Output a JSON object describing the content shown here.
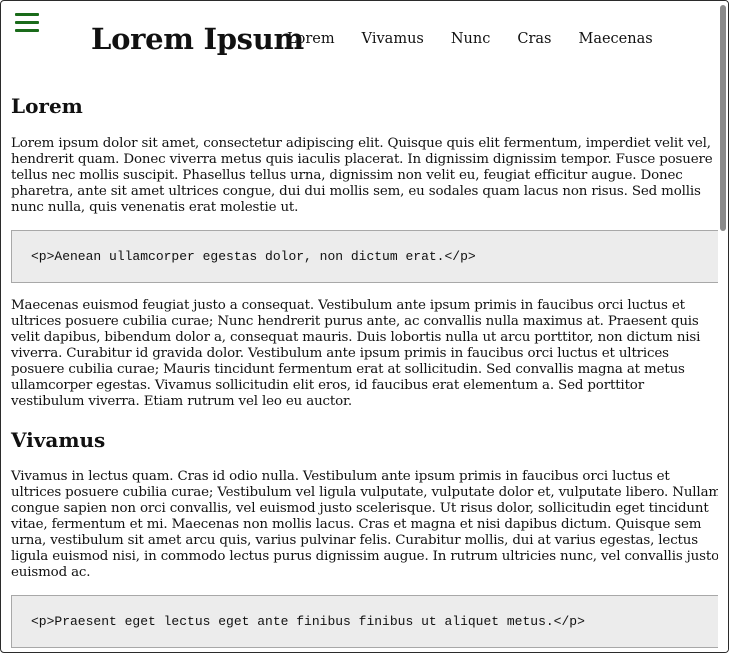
{
  "header": {
    "menu_icon": "hamburger-menu-icon",
    "title": "Lorem Ipsum",
    "nav": [
      "Lorem",
      "Vivamus",
      "Nunc",
      "Cras",
      "Maecenas"
    ]
  },
  "sections": [
    {
      "heading": "Lorem",
      "paragraph1": "Lorem ipsum dolor sit amet, consectetur adipiscing elit. Quisque quis elit fermentum, imperdiet velit vel, hendrerit quam. Donec viverra metus quis iaculis placerat. In dignissim dignissim tempor. Fusce posuere tellus nec mollis suscipit. Phasellus tellus urna, dignissim non velit eu, feugiat efficitur augue. Donec pharetra, ante sit amet ultrices congue, dui dui mollis sem, eu sodales quam lacus non risus. Sed mollis nunc nulla, quis venenatis erat molestie ut.",
      "code": "<p>Aenean ullamcorper egestas dolor, non dictum erat.</p>",
      "paragraph2": "Maecenas euismod feugiat justo a consequat. Vestibulum ante ipsum primis in faucibus orci luctus et ultrices posuere cubilia curae; Nunc hendrerit purus ante, ac convallis nulla maximus at. Praesent quis velit dapibus, bibendum dolor a, consequat mauris. Duis lobortis nulla ut arcu porttitor, non dictum nisi viverra. Curabitur id gravida dolor. Vestibulum ante ipsum primis in faucibus orci luctus et ultrices posuere cubilia curae; Mauris tincidunt fermentum erat at sollicitudin. Sed convallis magna at metus ullamcorper egestas. Vivamus sollicitudin elit eros, id faucibus erat elementum a. Sed porttitor vestibulum viverra. Etiam rutrum vel leo eu auctor."
    },
    {
      "heading": "Vivamus",
      "paragraph1": "Vivamus in lectus quam. Cras id odio nulla. Vestibulum ante ipsum primis in faucibus orci luctus et ultrices posuere cubilia curae; Vestibulum vel ligula vulputate, vulputate dolor et, vulputate libero. Nullam congue sapien non orci convallis, vel euismod justo scelerisque. Ut risus dolor, sollicitudin eget tincidunt vitae, fermentum et mi. Maecenas non mollis lacus. Cras et magna et nisi dapibus dictum. Quisque sem urna, vestibulum sit amet arcu quis, varius pulvinar felis. Curabitur mollis, dui at varius egestas, lectus ligula euismod nisi, in commodo lectus purus dignissim augue. In rutrum ultricies nunc, vel convallis justo euismod ac.",
      "code": "<p>Praesent eget lectus eget ante finibus finibus ut aliquet metus.</p>"
    }
  ],
  "colors": {
    "menu_icon": "#1a6b1a",
    "code_bg": "#ececec",
    "code_border": "#a8a8a8"
  }
}
